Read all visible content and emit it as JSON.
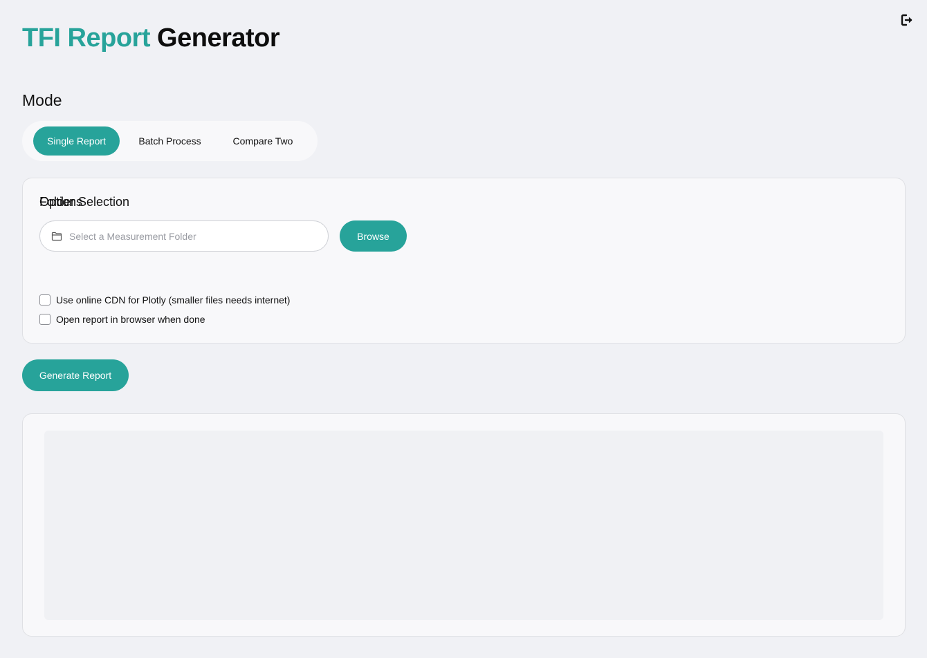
{
  "app": {
    "title_accent": "TFI Report",
    "title_rest": "Generator"
  },
  "icons": {
    "logout": "logout-icon",
    "folder": "folder-icon"
  },
  "colors": {
    "accent": "#27a39a",
    "background": "#f0f1f5",
    "card": "#f8f8fa"
  },
  "mode": {
    "heading": "Mode",
    "tabs": [
      {
        "label": "Single Report",
        "active": true
      },
      {
        "label": "Batch Process",
        "active": false
      },
      {
        "label": "Compare Two",
        "active": false
      }
    ]
  },
  "folder_selection": {
    "heading": "Folder Selection",
    "input_value": "",
    "placeholder": "Select a Measurement Folder",
    "browse_label": "Browse"
  },
  "options": {
    "heading": "Options",
    "items": [
      {
        "label": "Use online CDN for Plotly (smaller files needs internet)",
        "checked": false
      },
      {
        "label": "Open report in browser when done",
        "checked": false
      }
    ]
  },
  "actions": {
    "generate_label": "Generate Report"
  }
}
